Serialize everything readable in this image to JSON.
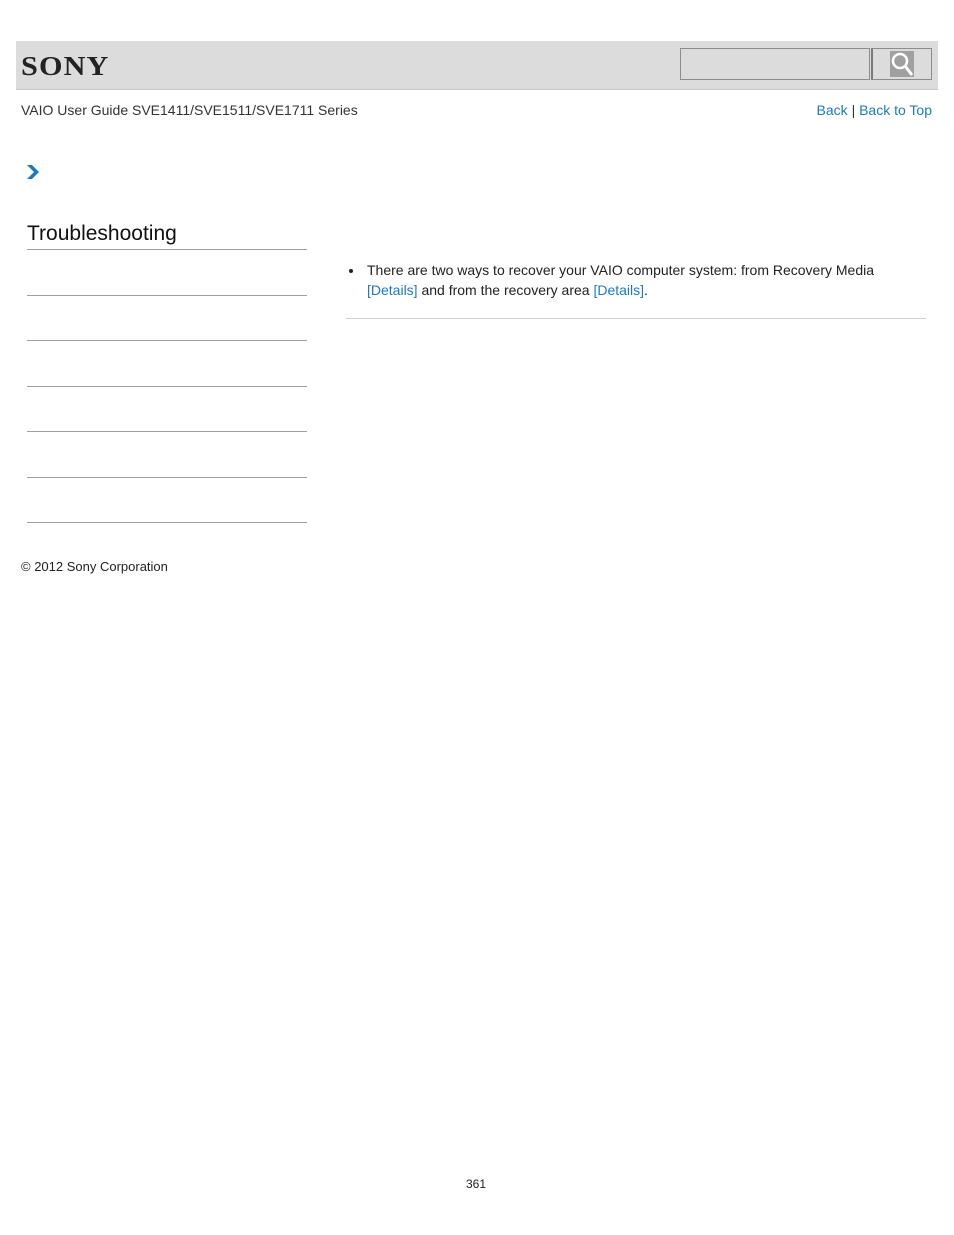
{
  "header": {
    "logo": "SONY",
    "search": {
      "value": "",
      "placeholder": ""
    },
    "search_icon": "magnifier-icon"
  },
  "subheader": {
    "guide_title": "VAIO User Guide SVE1411/SVE1511/SVE1711 Series",
    "links": {
      "back": "Back",
      "separator": "|",
      "back_to_top": "Back to Top"
    }
  },
  "breadcrumb": {
    "icon": "chevron-right-icon",
    "color": "#1a7ac8"
  },
  "sidebar": {
    "title": "Troubleshooting",
    "items": [
      "",
      "",
      "",
      "",
      "",
      ""
    ]
  },
  "content": {
    "bullet": {
      "text_1": "There are two ways to recover your VAIO computer system: from Recovery Media",
      "link_1": "[Details]",
      "text_2": " and from the recovery area ",
      "link_2": "[Details]",
      "text_3": "."
    }
  },
  "footer": {
    "copyright": "© 2012 Sony Corporation",
    "page_number": "361"
  },
  "colors": {
    "link": "#1a7ac8",
    "header_bg": "#dcdcdc"
  }
}
